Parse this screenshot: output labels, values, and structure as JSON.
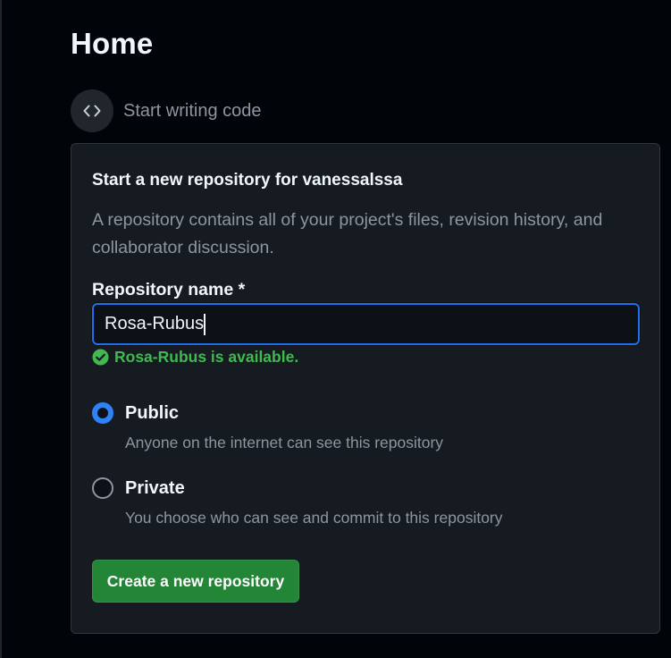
{
  "page": {
    "title": "Home"
  },
  "start": {
    "label": "Start writing code",
    "icon": "code-icon"
  },
  "new_repo": {
    "title": "Start a new repository for vanessalssa",
    "description": "A repository contains all of your project's files, revision history, and collaborator discussion.",
    "name_label": "Repository name *",
    "name_value": "Rosa-Rubus",
    "availability_text": "Rosa-Rubus is available.",
    "availability_icon": "check-circle-icon",
    "visibility": {
      "selected": "Public",
      "options": [
        {
          "label": "Public",
          "description": "Anyone on the internet can see this repository",
          "checked": true
        },
        {
          "label": "Private",
          "description": "You choose who can see and commit to this repository",
          "checked": false
        }
      ]
    },
    "create_button_label": "Create a new repository"
  },
  "colors": {
    "background": "#010409",
    "card": "#161b22",
    "accent_blue": "#2f81f7",
    "success_green": "#3fb950",
    "button_green": "#238636",
    "muted_text": "#8d96a0"
  }
}
